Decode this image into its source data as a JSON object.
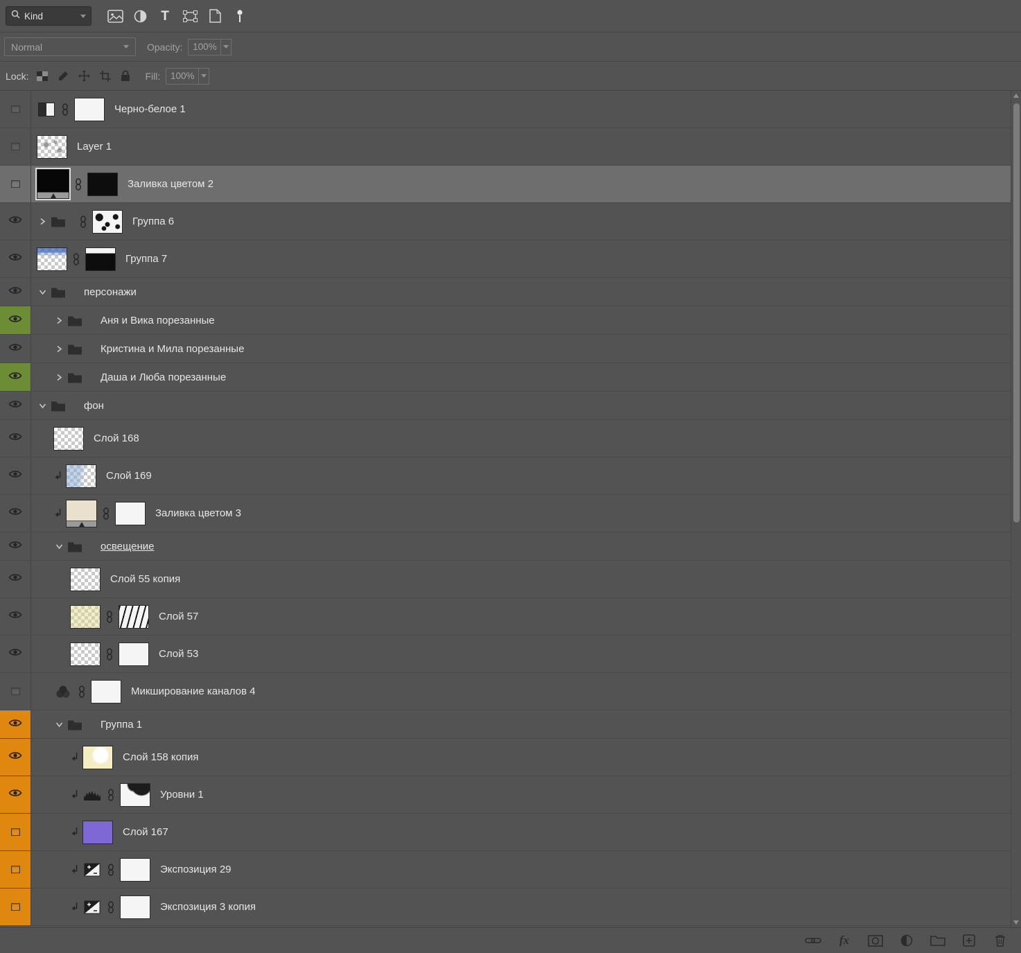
{
  "panel": {
    "kind_label": "Kind",
    "blend_mode": "Normal",
    "opacity_label": "Opacity:",
    "opacity_value": "100%",
    "lock_label": "Lock:",
    "fill_label": "Fill:",
    "fill_value": "100%",
    "fx_label": "fx"
  },
  "colors": {
    "panel_bg": "#535353",
    "selection_bg": "#6e6e6e",
    "green_label": "#6d8c36",
    "orange_label": "#e0870f"
  },
  "layers": [
    {
      "name": "Черно-белое 1",
      "indent": 0,
      "visible": false,
      "thumb": "bw-icon",
      "link": true,
      "mask": "white"
    },
    {
      "name": "Layer 1",
      "indent": 0,
      "visible": false,
      "thumb": "checker-marks"
    },
    {
      "name": "Заливка цветом 2",
      "indent": 0,
      "visible": false,
      "thumb": "fill-black",
      "link": true,
      "mask": "black",
      "selected": true
    },
    {
      "name": "Группа 6",
      "indent": 0,
      "visible": true,
      "group": "closed",
      "thumb": "spots",
      "link": true
    },
    {
      "name": "Группа 7",
      "indent": 0,
      "visible": true,
      "thumb": "checker-blue",
      "link": true,
      "mask": "black-whitetop"
    },
    {
      "name": "персонажи",
      "indent": 0,
      "visible": true,
      "group": "open"
    },
    {
      "name": "Аня и Вика порезанные",
      "indent": 1,
      "visible": true,
      "group": "closed",
      "label_color": "green"
    },
    {
      "name": "Кристина и Мила порезанные",
      "indent": 1,
      "visible": true,
      "group": "closed"
    },
    {
      "name": "Даша и Люба порезанные",
      "indent": 1,
      "visible": true,
      "group": "closed",
      "label_color": "green"
    },
    {
      "name": "фон",
      "indent": 0,
      "visible": true,
      "group": "open"
    },
    {
      "name": "Слой 168",
      "indent": 1,
      "visible": true,
      "thumb": "checker"
    },
    {
      "name": "Слой 169",
      "indent": 1,
      "visible": true,
      "clip": true,
      "thumb": "checker-blue2"
    },
    {
      "name": "Заливка цветом 3",
      "indent": 1,
      "visible": true,
      "clip": true,
      "thumb": "fill-cream",
      "link": true,
      "mask": "white"
    },
    {
      "name": "освещение",
      "indent": 1,
      "visible": true,
      "group": "open",
      "underline": true
    },
    {
      "name": "Слой 55 копия",
      "indent": 2,
      "visible": true,
      "thumb": "checker"
    },
    {
      "name": "Слой 57",
      "indent": 2,
      "visible": true,
      "thumb": "checker-yellow",
      "link": true,
      "mask": "hatch"
    },
    {
      "name": "Слой 53",
      "indent": 2,
      "visible": true,
      "thumb": "checker",
      "link": true,
      "mask": "white"
    },
    {
      "name": "Микширование каналов 4",
      "indent": 1,
      "visible": false,
      "thumb": "mixer-icon",
      "link": true,
      "mask": "white"
    },
    {
      "name": "Группа 1",
      "indent": 1,
      "visible": true,
      "group": "open",
      "label_color": "orange"
    },
    {
      "name": "Слой 158 копия",
      "indent": 2,
      "visible": true,
      "clip": true,
      "thumb": "pale-yellow",
      "label_color": "orange"
    },
    {
      "name": "Уровни 1",
      "indent": 2,
      "visible": true,
      "clip": true,
      "thumb": "levels-icon",
      "link": true,
      "mask": "white-blob",
      "label_color": "orange"
    },
    {
      "name": "Слой 167",
      "indent": 2,
      "visible": false,
      "clip": true,
      "thumb": "purple",
      "label_color": "orange"
    },
    {
      "name": "Экспозиция 29",
      "indent": 2,
      "visible": false,
      "clip": true,
      "thumb": "exposure-icon",
      "link": true,
      "mask": "white",
      "label_color": "orange"
    },
    {
      "name": "Экспозиция 3 копия",
      "indent": 2,
      "visible": false,
      "clip": true,
      "thumb": "exposure-icon",
      "link": true,
      "mask": "white",
      "label_color": "orange"
    }
  ]
}
